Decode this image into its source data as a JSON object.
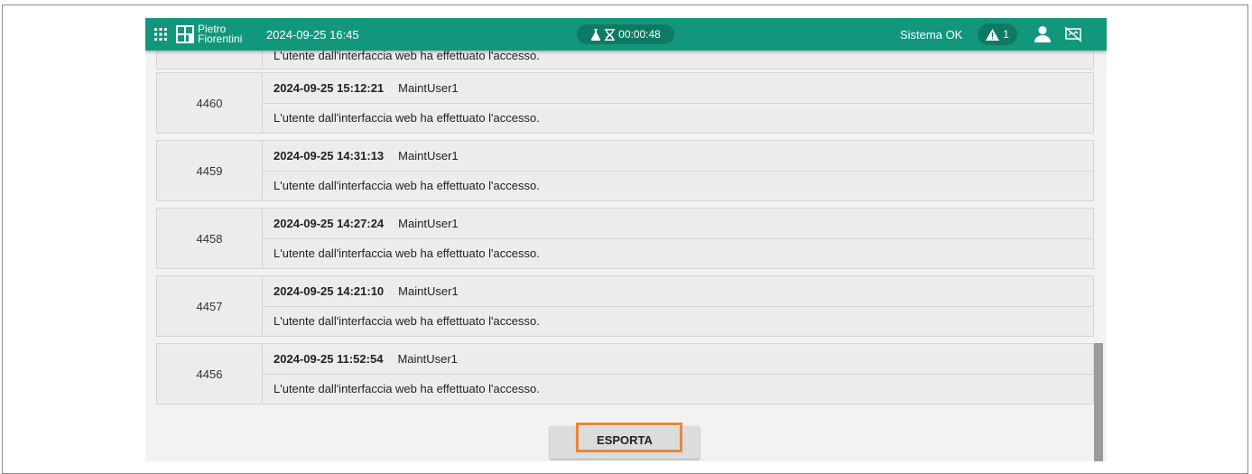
{
  "header": {
    "brand_line1": "Pietro",
    "brand_line2": "Fiorentini",
    "datetime": "2024-09-25 16:45",
    "timer": "00:00:48",
    "status": "Sistema OK",
    "alarm_count": "1",
    "icons": [
      "apps-grid-icon",
      "flask-icon",
      "hourglass-icon",
      "warning-icon",
      "user-icon",
      "network-disconnected-icon"
    ],
    "accent_color": "#13977c"
  },
  "partial_row": {
    "message": "L'utente dall'interfaccia web ha effettuato l'accesso."
  },
  "log": [
    {
      "id": "4460",
      "timestamp": "2024-09-25 15:12:21",
      "user": "MaintUser1",
      "message": "L'utente dall'interfaccia web ha effettuato l'accesso."
    },
    {
      "id": "4459",
      "timestamp": "2024-09-25 14:31:13",
      "user": "MaintUser1",
      "message": "L'utente dall'interfaccia web ha effettuato l'accesso."
    },
    {
      "id": "4458",
      "timestamp": "2024-09-25 14:27:24",
      "user": "MaintUser1",
      "message": "L'utente dall'interfaccia web ha effettuato l'accesso."
    },
    {
      "id": "4457",
      "timestamp": "2024-09-25 14:21:10",
      "user": "MaintUser1",
      "message": "L'utente dall'interfaccia web ha effettuato l'accesso."
    },
    {
      "id": "4456",
      "timestamp": "2024-09-25 11:52:54",
      "user": "MaintUser1",
      "message": "L'utente dall'interfaccia web ha effettuato l'accesso."
    }
  ],
  "export_button": {
    "label": "ESPORTA",
    "highlight_color": "#e8883a"
  }
}
